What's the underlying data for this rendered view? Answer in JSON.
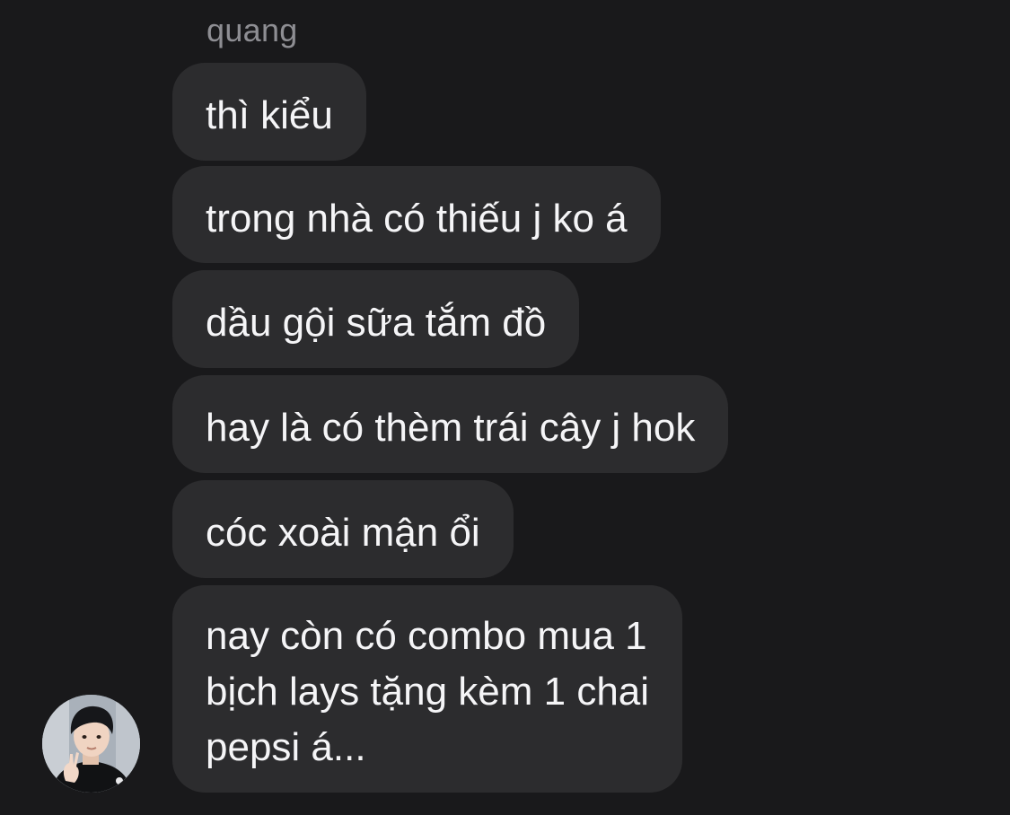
{
  "sender": {
    "name": "quang"
  },
  "messages": [
    {
      "text": "thì kiểu"
    },
    {
      "text": "trong nhà có thiếu j ko á"
    },
    {
      "text": "dầu gội sữa tắm đồ"
    },
    {
      "text": "hay là có thèm trái cây j hok"
    },
    {
      "text": "cóc xoài mận ổi"
    },
    {
      "text": "nay còn có combo mua 1\nbịch lays tặng kèm 1 chai\npepsi á..."
    }
  ],
  "avatar": {
    "icon": "user-avatar-photo"
  },
  "colors": {
    "background": "#19191b",
    "bubble": "#2c2c2e",
    "text": "#f5f5f7",
    "sender_name": "#8e8e93"
  }
}
